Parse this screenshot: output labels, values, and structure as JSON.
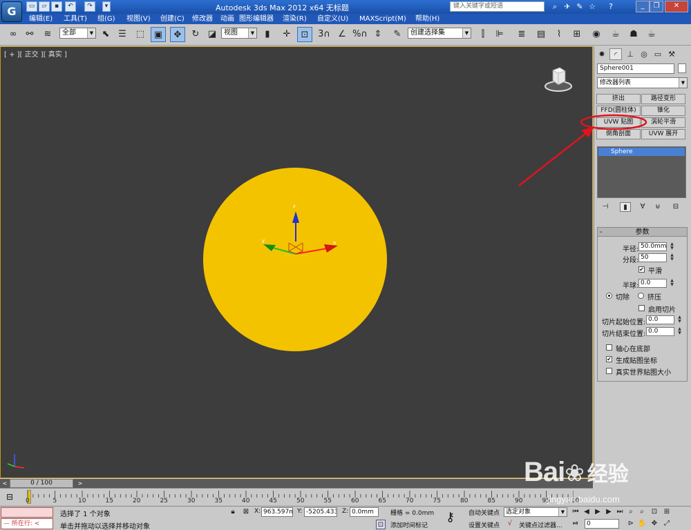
{
  "title_bar": {
    "title": "Autodesk 3ds Max  2012 x64      无标题",
    "help_search_placeholder": "键入关键字或短语"
  },
  "app_logo": "G",
  "menu": [
    "编辑(E)",
    "工具(T)",
    "组(G)",
    "视图(V)",
    "创建(C)",
    "修改器",
    "动画",
    "图形编辑器",
    "渲染(R)",
    "自定义(U)",
    "MAXScript(M)",
    "帮助(H)"
  ],
  "toolbar": {
    "selection_filter": "全部",
    "reference_coord": "视图",
    "named_selection": "创建选择集",
    "snap_labels": [
      "3",
      "%"
    ]
  },
  "viewport": {
    "label": "[ + ][ 正交 ][ 真实 ]",
    "object_color": "#f4c300",
    "gizmo_axes": {
      "x": "x",
      "y": "y",
      "z": "z"
    }
  },
  "command_panel": {
    "object_name": "Sphere001",
    "modifier_list": "修改器列表",
    "modifier_buttons": [
      "挤出",
      "路径变形",
      "FFD(圆柱体)",
      "锥化",
      "UVW 贴图",
      "涡轮平滑",
      "倒角剖面",
      "UVW 展开"
    ],
    "stack_item": "Sphere",
    "params": {
      "header": "参数",
      "radius_label": "半径:",
      "radius_value": "50.0mm",
      "segments_label": "分段:",
      "segments_value": "50",
      "smooth_label": "平滑",
      "hemisphere_label": "半球:",
      "hemisphere_value": "0.0",
      "chop_label": "切除",
      "squash_label": "挤压",
      "enable_slice_label": "启用切片",
      "slice_from_label": "切片起始位置:",
      "slice_from_value": "0.0",
      "slice_to_label": "切片结束位置:",
      "slice_to_value": "0.0",
      "base_to_pivot_label": "轴心在底部",
      "gen_map_coords_label": "生成贴图坐标",
      "real_world_label": "真实世界贴图大小"
    }
  },
  "timeline": {
    "frame_display": "0 / 100",
    "ticks": [
      "0",
      "5",
      "10",
      "15",
      "20",
      "25",
      "30",
      "35",
      "40",
      "45",
      "50",
      "55",
      "60",
      "65",
      "70",
      "75",
      "80",
      "85",
      "90",
      "95",
      "100"
    ]
  },
  "status": {
    "maxscript_prompt": "所在行:",
    "selection_info": "选择了 1 个对象",
    "prompt": "单击并拖动以选择并移动对象",
    "x_label": "X:",
    "x_value": "963.597mr",
    "y_label": "Y:",
    "y_value": "-5205.433",
    "z_label": "Z:",
    "z_value": "0.0mm",
    "grid": "栅格 = 0.0mm",
    "add_time_tag": "添加时间标记",
    "auto_key": "自动关键点",
    "set_key": "设置关键点",
    "selected_dropdown": "选定对象",
    "key_filters": "关键点过滤器...",
    "frame_value": "0"
  },
  "watermark": {
    "brand": "Bai",
    "brand_suffix": "经验",
    "url": "jingyan.baidu.com"
  },
  "annotation_color": "#e0141c"
}
